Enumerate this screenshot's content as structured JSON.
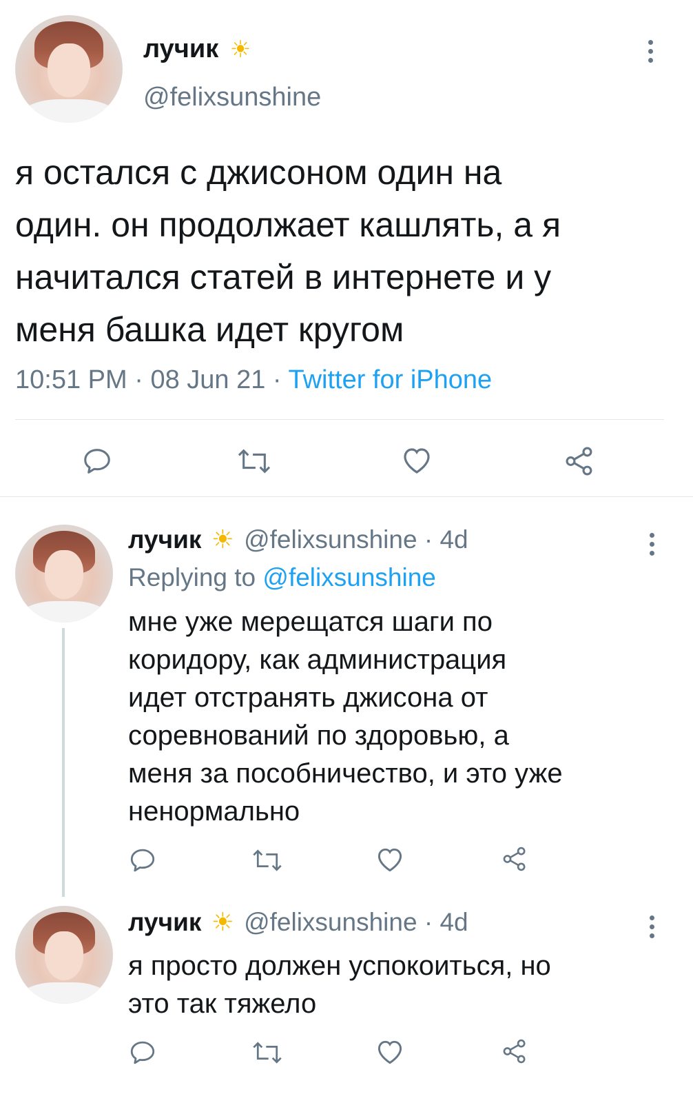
{
  "main_tweet": {
    "author_name": "лучик",
    "sun_icon": "☀",
    "handle": "@felixsunshine",
    "text_lines": [
      "я остался с джисоном один на",
      "один. он продолжает кашлять, а я",
      "начитался статей в интернете и у",
      "меня башка идет кругом"
    ],
    "time": "10:51 PM",
    "date": "08 Jun 21",
    "source": "Twitter for iPhone",
    "sep": "·"
  },
  "replies": [
    {
      "author_name": "лучик",
      "sun_icon": "☀",
      "handle": "@felixsunshine",
      "age": "4d",
      "replying_prefix": "Replying to ",
      "replying_handle": "@felixsunshine",
      "text_lines": [
        "мне уже мерещатся шаги по",
        "коридору, как администрация",
        "идет отстранять джисона от",
        "соревнований по здоровью, а",
        "меня за пособничество, и это уже",
        "ненормально"
      ]
    },
    {
      "author_name": "лучик",
      "sun_icon": "☀",
      "handle": "@felixsunshine",
      "age": "4d",
      "text_lines": [
        "я просто должен успокоиться, но",
        "это так тяжело"
      ]
    }
  ],
  "icons": {
    "reply": "reply-icon",
    "retweet": "retweet-icon",
    "like": "heart-icon",
    "share": "share-icon",
    "more": "more-vertical-icon"
  },
  "colors": {
    "text": "#14171a",
    "secondary": "#657786",
    "link": "#1da1f2",
    "divider": "#e1e8ed",
    "sun": "#f5b800"
  }
}
